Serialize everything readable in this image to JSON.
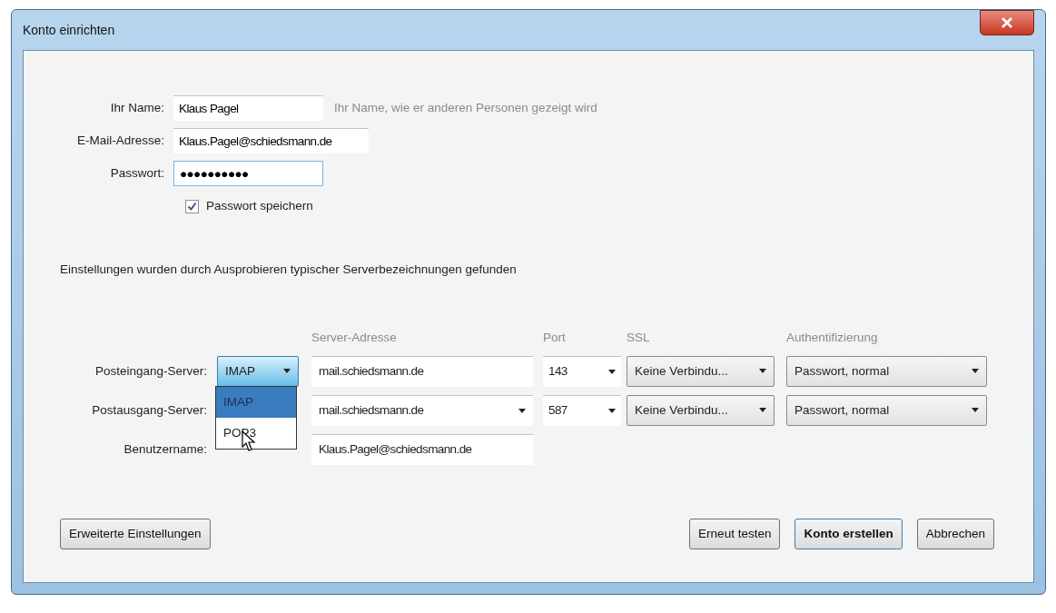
{
  "window": {
    "title": "Konto einrichten"
  },
  "name_field": {
    "label": "Ihr Name:",
    "value": "Klaus Pagel",
    "hint": "Ihr Name, wie er anderen Personen gezeigt wird"
  },
  "email_field": {
    "label": "E-Mail-Adresse:",
    "value": "Klaus.Pagel@schiedsmann.de"
  },
  "password_field": {
    "label": "Passwort:",
    "value": "●●●●●●●●●●"
  },
  "remember_password": {
    "label": "Passwort speichern",
    "checked": true
  },
  "status_message": "Einstellungen wurden durch Ausprobieren typischer Serverbezeichnungen gefunden",
  "server_columns": [
    "Server-Adresse",
    "Port",
    "SSL",
    "Authentifizierung"
  ],
  "incoming_server": {
    "label": "Posteingang-Server:",
    "protocol": "IMAP",
    "expanded": true,
    "options": [
      {
        "label": "IMAP",
        "selected": true
      },
      {
        "label": "POP3",
        "selected": false
      }
    ],
    "address": "mail.schiedsmann.de",
    "port": "143",
    "ssl": "Keine Verbindu...",
    "auth": "Passwort, normal"
  },
  "outgoing_server": {
    "label": "Postausgang-Server:",
    "address": "mail.schiedsmann.de",
    "port": "587",
    "ssl": "Keine Verbindu...",
    "auth": "Passwort, normal"
  },
  "username": {
    "label": "Benutzername:",
    "value": "Klaus.Pagel@schiedsmann.de"
  },
  "buttons": [
    {
      "label": "Erweiterte Einstellungen",
      "kind": "normal"
    },
    {
      "label": "Erneut testen",
      "kind": "normal"
    },
    {
      "label": "Konto erstellen",
      "kind": "default"
    },
    {
      "label": "Abbrechen",
      "kind": "normal"
    }
  ]
}
